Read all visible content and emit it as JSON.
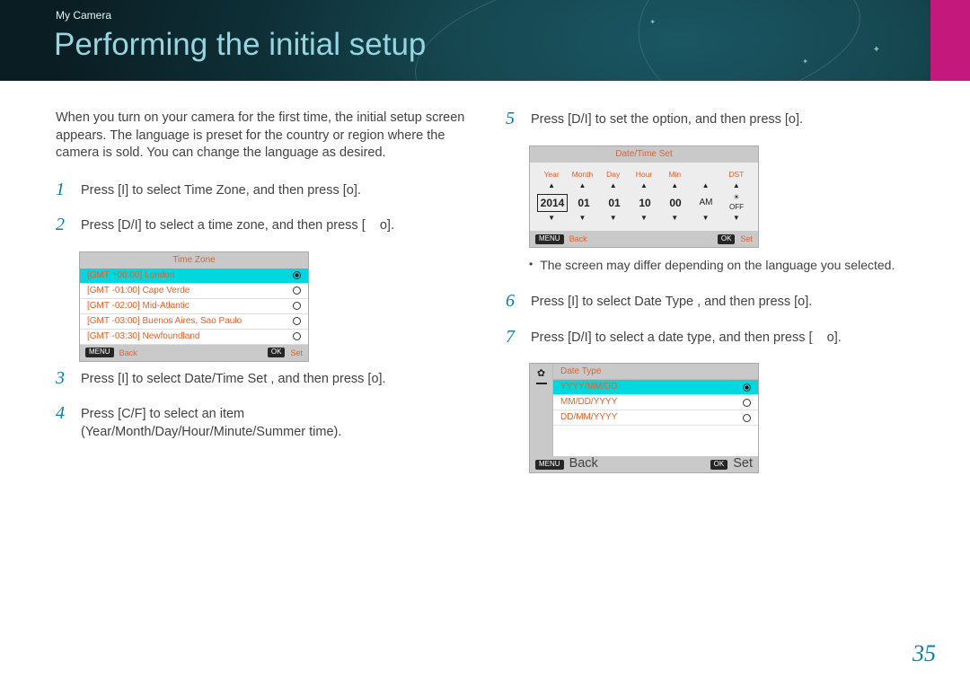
{
  "breadcrumb": "My Camera",
  "title": "Performing the initial setup",
  "intro": "When you turn on your camera for the first time, the initial setup screen appears. The language is preset for the country or region where the camera is sold. You can change the language as desired.",
  "page_number": "35",
  "footer": {
    "back_chip": "MENU",
    "back_label": "Back",
    "ok_chip": "OK",
    "set_label": "Set"
  },
  "steps": {
    "s1": "Press [I] to select Time Zone, and then press [o].",
    "s2": "Press [D/I] to select a time zone, and then press [    o].",
    "s3": "Press [I] to select Date/Time Set , and then press [o].",
    "s4": "Press [C/F] to select an item (Year/Month/Day/Hour/Minute/Summer time).",
    "s5": "Press [D/I] to set the option, and then press [o].",
    "s6": "Press [I] to select Date Type , and then press [o].",
    "s7": "Press [D/I] to select a date type, and then press [    o]."
  },
  "timezone_panel": {
    "title": "Time Zone",
    "rows": [
      "[GMT +00:00] London",
      "[GMT -01:00] Cape Verde",
      "[GMT -02:00] Mid-Atlantic",
      "[GMT -03:00] Buenos Aires, Sao Paulo",
      "[GMT -03:30] Newfoundland"
    ]
  },
  "datetime_panel": {
    "title": "Date/Time Set",
    "labels": [
      "Year",
      "Month",
      "Day",
      "Hour",
      "Min",
      "",
      "DST"
    ],
    "values": [
      "2014",
      "01",
      "01",
      "10",
      "00",
      "AM",
      "OFF"
    ]
  },
  "note": "The screen may differ depending on the language you selected.",
  "datetype_panel": {
    "title": "Date Type",
    "rows": [
      "YYYY/MM/DD",
      "MM/DD/YYYY",
      "DD/MM/YYYY"
    ]
  }
}
